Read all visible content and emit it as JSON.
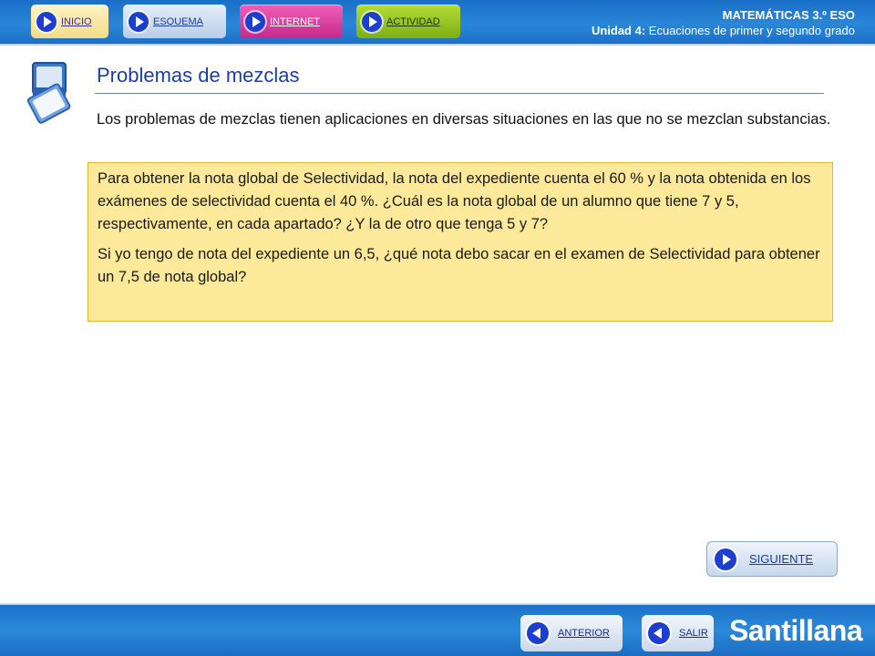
{
  "nav": {
    "inicio": "INICIO",
    "esquema": "ESQUEMA",
    "internet": "INTERNET",
    "actividad": "ACTIVIDAD"
  },
  "course": {
    "subject": "MATEMÁTICAS 3.º ESO",
    "unit_label": "Unidad 4:",
    "unit_title": "Ecuaciones de primer y segundo grado"
  },
  "section": {
    "title": "Problemas de mezclas",
    "intro": "Los problemas de mezclas tienen aplicaciones en diversas situaciones en las que no se mezclan substancias."
  },
  "problem": {
    "paragraph_1": "Para obtener la nota global de Selectividad, la nota del expediente cuenta el 60 % y la nota obtenida en los exámenes de selectividad cuenta el 40 %. ¿Cuál es la nota global de un alumno que tiene 7 y 5, respectivamente, en cada apartado? ¿Y la de otro que tenga 5 y 7?",
    "paragraph_2": "Si yo tengo de nota del expediente un 6,5, ¿qué nota debo sacar en el examen de Selectividad para obtener un 7,5 de nota global?"
  },
  "buttons": {
    "siguiente": "SIGUIENTE",
    "anterior": "ANTERIOR",
    "salir": "SALIR"
  },
  "brand": "Santillana",
  "colors": {
    "header_blue": "#1f78cf",
    "title_blue": "#1b3ea6",
    "problem_bg": "#fde99a",
    "problem_border": "#e0b530"
  },
  "icons": {
    "nav": "play-icon",
    "back": "back-arrow-icon",
    "section": "notebook-icon"
  }
}
